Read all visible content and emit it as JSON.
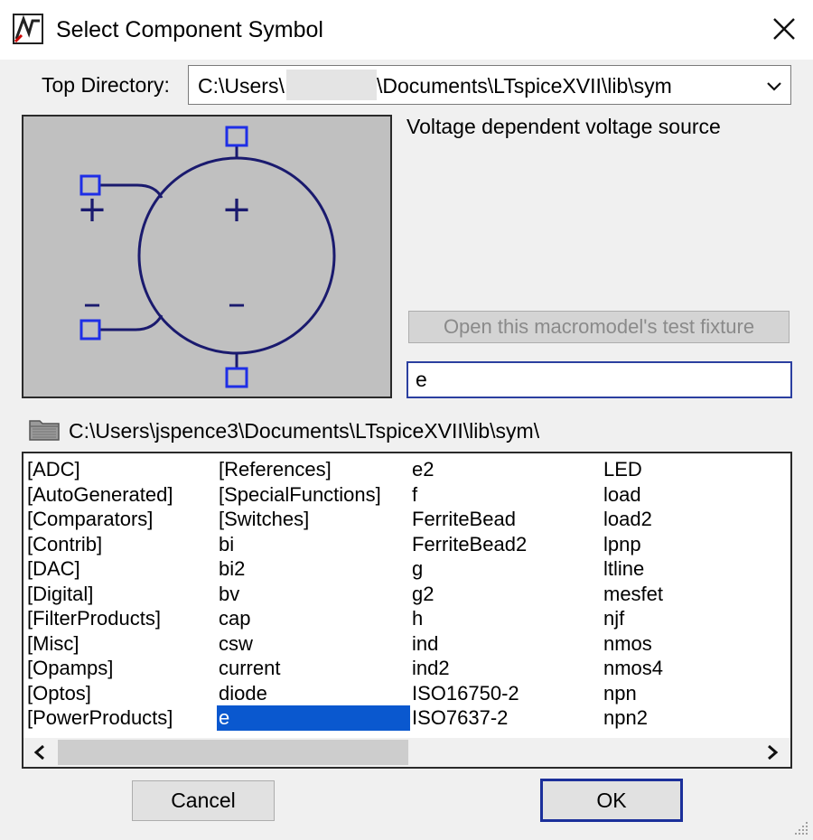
{
  "window": {
    "title": "Select Component Symbol",
    "close_glyph": "✕"
  },
  "top_directory": {
    "label": "Top Directory:",
    "value_prefix": "C:\\Users\\",
    "value_suffix": "\\Documents\\LTspiceXVII\\lib\\sym"
  },
  "symbol": {
    "description": "Voltage dependent voltage source",
    "preview_plus_left": "+",
    "preview_minus_left": "–",
    "preview_plus_center": "+",
    "preview_minus_center": "–"
  },
  "fixture_button_label": "Open this macromodel's test fixture",
  "search": {
    "value": "e"
  },
  "current_path": "C:\\Users\\jspence3\\Documents\\LTspiceXVII\\lib\\sym\\",
  "list": {
    "columns": [
      [
        "[ADC]",
        "[AutoGenerated]",
        "[Comparators]",
        "[Contrib]",
        "[DAC]",
        "[Digital]",
        "[FilterProducts]",
        "[Misc]",
        "[Opamps]",
        "[Optos]",
        "[PowerProducts]"
      ],
      [
        "[References]",
        "[SpecialFunctions]",
        "[Switches]",
        "bi",
        "bi2",
        "bv",
        "cap",
        "csw",
        "current",
        "diode",
        "e"
      ],
      [
        "e2",
        "f",
        "FerriteBead",
        "FerriteBead2",
        "g",
        "g2",
        "h",
        "ind",
        "ind2",
        "ISO16750-2",
        "ISO7637-2"
      ],
      [
        "LED",
        "load",
        "load2",
        "lpnp",
        "ltline",
        "mesfet",
        "njf",
        "nmos",
        "nmos4",
        "npn",
        "npn2"
      ]
    ],
    "selected": "e"
  },
  "buttons": {
    "cancel": "Cancel",
    "ok": "OK"
  },
  "icons": {
    "app": "ltspice-app-icon",
    "close": "close-icon",
    "dropdown": "chevron-down-icon",
    "folder": "folder-icon",
    "scroll_left": "scroll-left-arrow-icon",
    "scroll_right": "scroll-right-arrow-icon",
    "grip": "resize-grip-icon"
  },
  "colors": {
    "selection": "#0a58cf",
    "focus_border": "#1b2f9a",
    "symbol_stroke": "#1a1a6e",
    "pin_box": "#1e2ee6",
    "preview_bg": "#c0c0c0"
  }
}
